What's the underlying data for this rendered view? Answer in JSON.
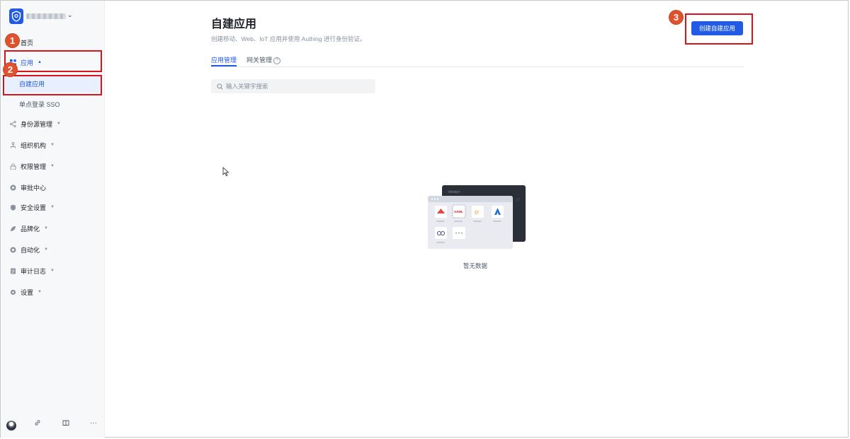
{
  "sidebar": {
    "home": "首页",
    "apps": "应用",
    "sub_items": [
      "自建应用",
      "单点登录 SSO"
    ],
    "items": [
      {
        "label": "身份源管理",
        "icon": "share-icon",
        "caret": true
      },
      {
        "label": "组织机构",
        "icon": "org-icon",
        "caret": true
      },
      {
        "label": "权限管理",
        "icon": "lock-icon",
        "caret": true
      },
      {
        "label": "审批中心",
        "icon": "approval-icon",
        "caret": false
      },
      {
        "label": "安全设置",
        "icon": "shield-icon",
        "caret": true
      },
      {
        "label": "品牌化",
        "icon": "brand-icon",
        "caret": true
      },
      {
        "label": "自动化",
        "icon": "automation-icon",
        "caret": true
      },
      {
        "label": "审计日志",
        "icon": "audit-log-icon",
        "caret": true
      },
      {
        "label": "设置",
        "icon": "settings-icon",
        "caret": true
      }
    ],
    "bottom_icons": [
      "avatar",
      "link-icon",
      "book-icon",
      "more-icon"
    ],
    "more_glyph": "···"
  },
  "main": {
    "title": "自建应用",
    "description": "创建移动、Web、IoT 应用并使用 Authing 进行身份验证。",
    "tabs": [
      {
        "label": "应用管理",
        "active": true
      },
      {
        "label": "网关管理",
        "active": false
      }
    ],
    "search_placeholder": "输入关键字搜索",
    "create_button": "创建自建应用",
    "empty_text": "暂无数据"
  },
  "illustration": {
    "code_tag": "<body>",
    "saml_label": "SAML"
  },
  "annotations": [
    "1",
    "2",
    "3"
  ],
  "colors": {
    "accent": "#215ae5",
    "annotation_box": "#d9131b",
    "annotation_badge": "#e0522d",
    "sidebar_bg": "#f7f8fa"
  }
}
